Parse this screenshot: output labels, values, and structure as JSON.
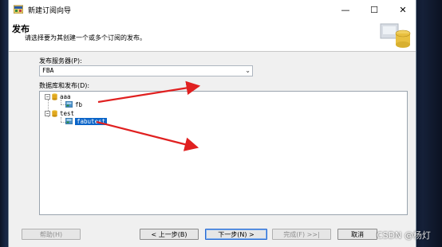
{
  "window": {
    "title": "新建订阅向导",
    "minimize_glyph": "—",
    "maximize_glyph": "☐",
    "close_glyph": "✕"
  },
  "header": {
    "title": "发布",
    "subtitle": "请选择要为其创建一个或多个订阅的发布。"
  },
  "publisher": {
    "label": "发布服务器(P):",
    "value": "FBA"
  },
  "tree": {
    "label": "数据库和发布(D):",
    "nodes": [
      {
        "type": "database",
        "expander": "−",
        "name": "aaa"
      },
      {
        "type": "publication",
        "name": "fb"
      },
      {
        "type": "database",
        "expander": "−",
        "name": "test"
      },
      {
        "type": "publication",
        "name": "fabutest",
        "selected": true
      }
    ]
  },
  "buttons": {
    "help": "帮助(H)",
    "back": "< 上一步(B)",
    "next": "下一步(N) >",
    "finish": "完成(F) >>|",
    "cancel": "取消"
  },
  "watermark": "CSDN @杨灯",
  "colors": {
    "selection": "#0a64c8",
    "annotation_arrow": "#e02020"
  }
}
